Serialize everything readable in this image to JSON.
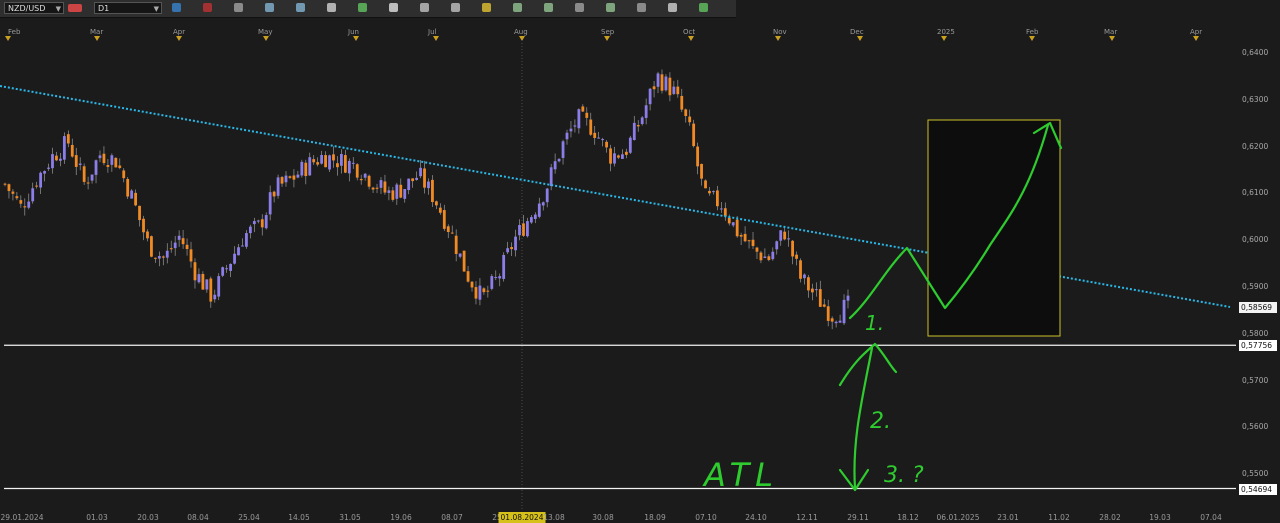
{
  "toolbar": {
    "symbol": "NZD/USD",
    "timeframe": "D1",
    "icons": [
      "chart-type-icon",
      "indicator-icon",
      "crosshair-icon",
      "zoom-in-icon",
      "zoom-out-icon",
      "grid-icon",
      "line-tool-icon",
      "text-tool-icon",
      "rectangle-tool-icon",
      "pen-icon",
      "arrow-icon",
      "fibonacci-icon",
      "channel-icon",
      "pitchfork-icon",
      "gann-icon",
      "ellipse-icon",
      "eraser-icon",
      "settings-icon"
    ]
  },
  "months": [
    "Feb",
    "Mar",
    "Apr",
    "May",
    "Jun",
    "Jul",
    "Aug",
    "Sep",
    "Oct",
    "Nov",
    "Dec",
    "2025",
    "Feb",
    "Mar",
    "Apr"
  ],
  "dates": [
    "29.01.2024",
    "01.03",
    "20.03",
    "08.04",
    "25.04",
    "14.05",
    "31.05",
    "19.06",
    "08.07",
    "25.07",
    "01.08.2024",
    "13.08",
    "30.08",
    "18.09",
    "07.10",
    "24.10",
    "12.11",
    "29.11",
    "18.12",
    "06.01.2025",
    "23.01",
    "11.02",
    "28.02",
    "19.03",
    "07.04"
  ],
  "price_axis": [
    "0,6400",
    "0,6300",
    "0,6200",
    "0,6100",
    "0,6000",
    "0,5900",
    "0,5800",
    "0,5700",
    "0,5600",
    "0,5500"
  ],
  "price_tags": {
    "current": "0,58569",
    "support": "0,57756",
    "atl": "0,54694"
  },
  "annotations": {
    "label_1": "1.",
    "label_2": "2.",
    "label_3": "3. ?",
    "atl": "ATL"
  },
  "colors": {
    "bull": "#8b7ee8",
    "bear": "#f08a24",
    "trendline": "#2ab8e8",
    "drawing": "#2ecc2e",
    "box_border": "#c9c22a",
    "background": "#1b1b1b"
  },
  "chart_data": {
    "type": "candlestick",
    "symbol": "NZD/USD",
    "timeframe": "D1",
    "ylim": [
      0.543,
      0.643
    ],
    "horizontal_levels": [
      0.57756,
      0.54694
    ],
    "trendline": {
      "from": [
        "29.01.2024",
        0.6325
      ],
      "to": [
        "07.04",
        0.5865
      ]
    },
    "close_path": [
      [
        "29.01.2024",
        0.612
      ],
      [
        "05.02",
        0.607
      ],
      [
        "12.02",
        0.613
      ],
      [
        "19.02",
        0.618
      ],
      [
        "26.02",
        0.621
      ],
      [
        "01.03",
        0.612
      ],
      [
        "08.03",
        0.6185
      ],
      [
        "13.03",
        0.617
      ],
      [
        "20.03",
        0.609
      ],
      [
        "27.03",
        0.599
      ],
      [
        "03.04",
        0.596
      ],
      [
        "08.04",
        0.601
      ],
      [
        "15.04",
        0.593
      ],
      [
        "20.04",
        0.588
      ],
      [
        "25.04",
        0.5945
      ],
      [
        "02.05",
        0.601
      ],
      [
        "08.05",
        0.603
      ],
      [
        "14.05",
        0.611
      ],
      [
        "21.05",
        0.613
      ],
      [
        "27.05",
        0.616
      ],
      [
        "31.05",
        0.618
      ],
      [
        "06.06",
        0.617
      ],
      [
        "12.06",
        0.616
      ],
      [
        "19.06",
        0.613
      ],
      [
        "26.06",
        0.61
      ],
      [
        "03.07",
        0.611
      ],
      [
        "08.07",
        0.614
      ],
      [
        "15.07",
        0.609
      ],
      [
        "20.07",
        0.602
      ],
      [
        "25.07",
        0.593
      ],
      [
        "30.07",
        0.5875
      ],
      [
        "01.08.2024",
        0.592
      ],
      [
        "07.08",
        0.6
      ],
      [
        "13.08",
        0.605
      ],
      [
        "19.08",
        0.611
      ],
      [
        "24.08",
        0.62
      ],
      [
        "30.08",
        0.626
      ],
      [
        "05.09",
        0.624
      ],
      [
        "11.09",
        0.618
      ],
      [
        "18.09",
        0.619
      ],
      [
        "24.09",
        0.626
      ],
      [
        "30.09",
        0.635
      ],
      [
        "03.10",
        0.632
      ],
      [
        "07.10",
        0.624
      ],
      [
        "14.10",
        0.609
      ],
      [
        "19.10",
        0.608
      ],
      [
        "24.10",
        0.602
      ],
      [
        "30.10",
        0.598
      ],
      [
        "05.11",
        0.596
      ],
      [
        "08.11",
        0.602
      ],
      [
        "12.11",
        0.592
      ],
      [
        "18.11",
        0.588
      ],
      [
        "22.11",
        0.584
      ],
      [
        "26.11",
        0.586
      ]
    ]
  }
}
